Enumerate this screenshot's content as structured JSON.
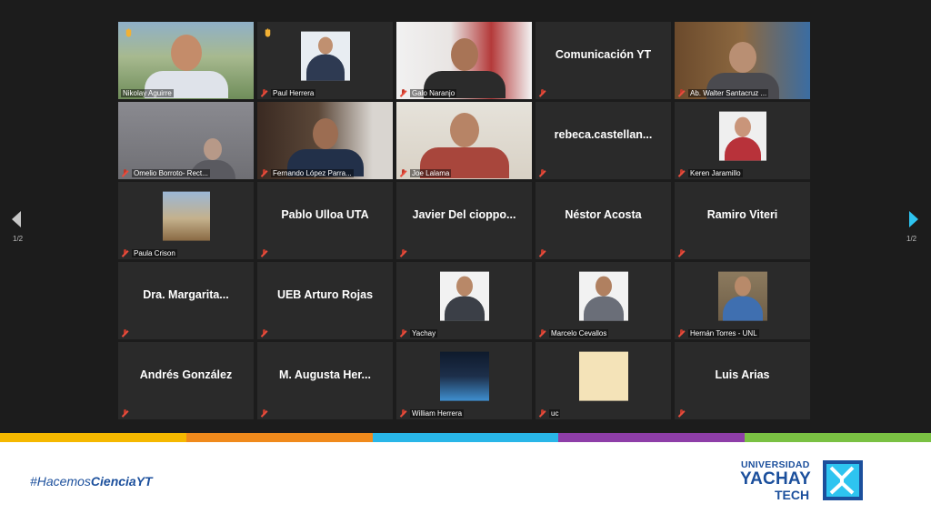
{
  "meeting": {
    "page_indicator_left": "1/2",
    "page_indicator_right": "1/2"
  },
  "participants": [
    {
      "name": "Nikolay Aguirre",
      "display": "video",
      "hand_raised": true,
      "muted": false,
      "active": true
    },
    {
      "name": "Paul Herrera",
      "display": "photo",
      "hand_raised": true,
      "muted": true
    },
    {
      "name": "Galo Naranjo",
      "display": "video",
      "muted": true
    },
    {
      "name": "Comunicación YT",
      "display": "name",
      "muted": true
    },
    {
      "name": "Ab. Walter Santacruz ...",
      "display": "video",
      "muted": true
    },
    {
      "name": "Omelio Borroto- Rect...",
      "display": "video",
      "muted": true
    },
    {
      "name": "Fernando López Parra...",
      "display": "video",
      "muted": true
    },
    {
      "name": "Joe Lalama",
      "display": "video",
      "muted": true
    },
    {
      "name": "rebeca.castellan...",
      "display": "name",
      "muted": true
    },
    {
      "name": "Keren Jaramillo",
      "display": "photo",
      "muted": true
    },
    {
      "name": "Paula Crison",
      "display": "photo",
      "muted": true
    },
    {
      "name": "Pablo Ulloa UTA",
      "display": "name",
      "muted": true
    },
    {
      "name": "Javier  Del  cioppo...",
      "display": "name",
      "muted": true
    },
    {
      "name": "Néstor Acosta",
      "display": "name",
      "muted": true
    },
    {
      "name": "Ramiro Viteri",
      "display": "name",
      "muted": true
    },
    {
      "name": "Dra.  Margarita...",
      "display": "name",
      "muted": true
    },
    {
      "name": "UEB Arturo Rojas",
      "display": "name",
      "muted": true
    },
    {
      "name": "Yachay",
      "display": "photo",
      "muted": true
    },
    {
      "name": "Marcelo Cevallos",
      "display": "photo",
      "muted": true
    },
    {
      "name": "Hernán Torres - UNL",
      "display": "photo",
      "muted": true
    },
    {
      "name": "Andrés González",
      "display": "name",
      "muted": true
    },
    {
      "name": "M.  Augusta  Her...",
      "display": "name",
      "muted": true
    },
    {
      "name": "William Herrera",
      "display": "photo",
      "muted": true
    },
    {
      "name": "uc",
      "display": "photo",
      "muted": true
    },
    {
      "name": "Luis Arias",
      "display": "name",
      "muted": true
    }
  ],
  "footer": {
    "hashtag_prefix": "#Hacemos",
    "hashtag_bold": "CienciaYT",
    "logo_line1": "UNIVERSIDAD",
    "logo_line2": "YACHAY",
    "logo_line3": "TECH"
  },
  "colors": {
    "background": "#1c1c1c",
    "tile": "#2a2a2a",
    "active_outline": "#c9e23a",
    "brand_blue": "#1b4f9c",
    "next_arrow": "#2ec4f0",
    "stripe": [
      "#f5b800",
      "#f08a1c",
      "#29b6e8",
      "#8e3ea8",
      "#7ac143"
    ]
  },
  "icons": {
    "muted_mic": "muted-mic-icon",
    "raised_hand": "raised-hand-icon",
    "prev_page": "chevron-left-icon",
    "next_page": "chevron-right-icon"
  }
}
